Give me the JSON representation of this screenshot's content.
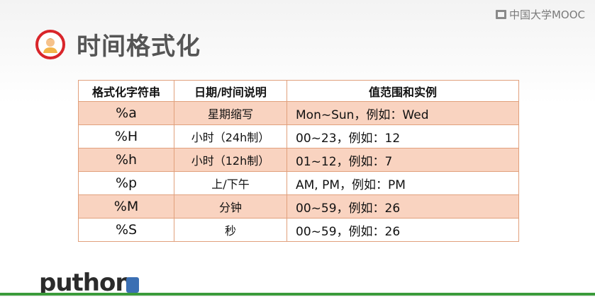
{
  "watermark": {
    "text": "中国大学MOOC"
  },
  "header": {
    "title": "时间格式化",
    "avatar_icon": "person-avatar-icon"
  },
  "table": {
    "headers": [
      "格式化字符串",
      "日期/时间说明",
      "值范围和实例"
    ],
    "rows": [
      [
        "%a",
        "星期缩写",
        "Mon~Sun，例如：Wed"
      ],
      [
        "%H",
        "小时（24h制）",
        "00~23，例如：12"
      ],
      [
        "%h",
        "小时（12h制）",
        "01~12，例如：7"
      ],
      [
        "%p",
        "上/下午",
        "AM, PM，例如：PM"
      ],
      [
        "%M",
        "分钟",
        "00~59，例如：26"
      ],
      [
        "%S",
        "秒",
        "00~59，例如：26"
      ]
    ]
  },
  "footer": {
    "logo_text": "puthon"
  },
  "colors": {
    "accent": "#d9252a",
    "row_highlight": "#f9d3c0",
    "border": "#e1a07c"
  }
}
